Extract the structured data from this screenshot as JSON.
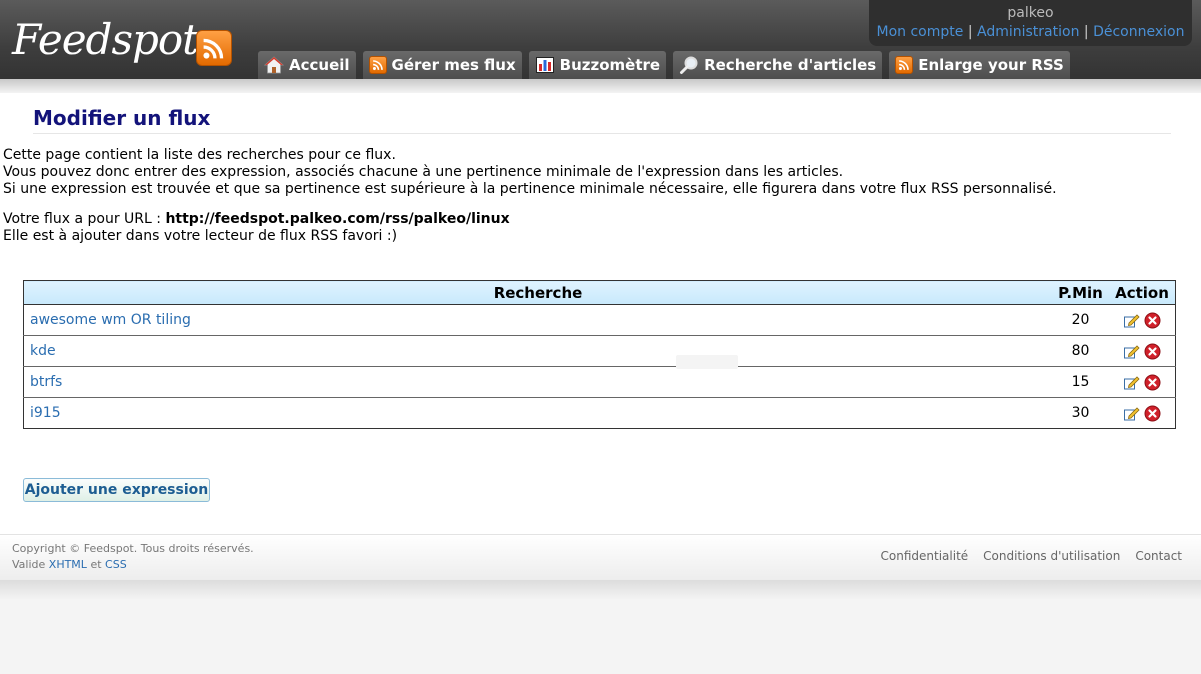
{
  "header": {
    "logo_text": "Feedspot",
    "user": {
      "name": "palkeo",
      "links": [
        "Mon compte",
        "Administration",
        "Déconnexion"
      ],
      "separator": "|"
    },
    "tabs": [
      {
        "label": "Accueil",
        "icon": "home-icon"
      },
      {
        "label": "Gérer mes flux",
        "icon": "rss-icon"
      },
      {
        "label": "Buzzomètre",
        "icon": "chart-icon"
      },
      {
        "label": "Recherche d'articles",
        "icon": "magnifier-icon"
      },
      {
        "label": "Enlarge your RSS",
        "icon": "rss-icon"
      }
    ]
  },
  "main": {
    "title": "Modifier un flux",
    "intro": [
      "Cette page contient la liste des recherches pour ce flux.",
      "Vous pouvez donc entrer des expression, associés chacune à une pertinence minimale de l'expression dans les articles.",
      "Si une expression est trouvée et que sa pertinence est supérieure à la pertinence minimale nécessaire, elle figurera dans votre flux RSS personnalisé."
    ],
    "url_prefix": "Votre flux a pour URL : ",
    "url": "http://feedspot.palkeo.com/rss/palkeo/linux",
    "url_note": "Elle est à ajouter dans votre lecteur de flux RSS favori :)",
    "table": {
      "headers": [
        "Recherche",
        "P.Min",
        "Action"
      ],
      "rows": [
        {
          "search": "awesome wm OR tiling",
          "pmin": "20"
        },
        {
          "search": "kde",
          "pmin": "80"
        },
        {
          "search": "btrfs",
          "pmin": "15"
        },
        {
          "search": "i915",
          "pmin": "30"
        }
      ]
    },
    "add_button": "Ajouter une expression"
  },
  "footer": {
    "copyright": "Copyright © Feedspot. Tous droits réservés.",
    "valid_prefix": "Valide",
    "valid_xhtml": "XHTML",
    "valid_and": "et",
    "valid_css": "CSS",
    "links": [
      "Confidentialité",
      "Conditions d'utilisation",
      "Contact"
    ]
  },
  "colors": {
    "title": "#13137a",
    "link": "#2a6db0",
    "rss_orange": "#f08a1c",
    "table_header": "#d4eefc"
  }
}
